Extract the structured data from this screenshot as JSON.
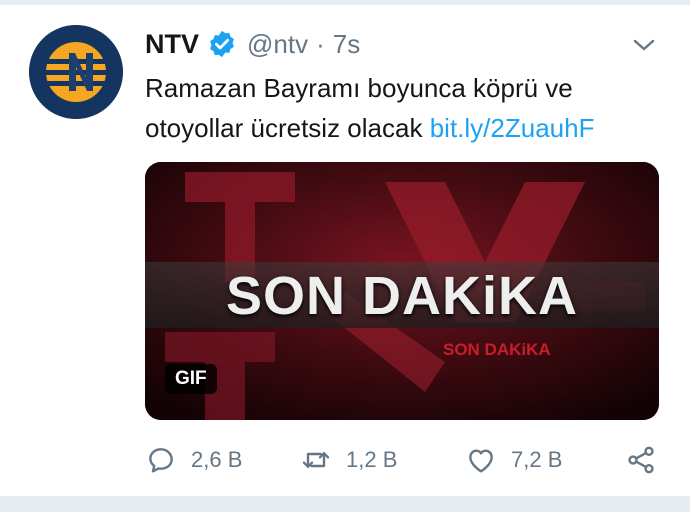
{
  "tweet": {
    "display_name": "NTV",
    "handle": "@ntv",
    "separator": "·",
    "time": "7s",
    "text_plain": "Ramazan Bayramı boyunca köprü ve otoyollar ücretsiz olacak",
    "link": "bit.ly/2ZuauhF",
    "verified": true
  },
  "media": {
    "banner_title": "SON DAKiKA",
    "banner_sub": "SON DAKiKA",
    "badge": "GIF",
    "accent_color": "#c91d2a"
  },
  "actions": {
    "reply_count": "2,6 B",
    "retweet_count": "1,2 B",
    "like_count": "7,2 B",
    "icons": [
      "reply-icon",
      "retweet-icon",
      "like-icon",
      "share-icon"
    ]
  },
  "colors": {
    "link": "#1da1f2",
    "muted": "#657786",
    "verified": "#1da1f2"
  }
}
